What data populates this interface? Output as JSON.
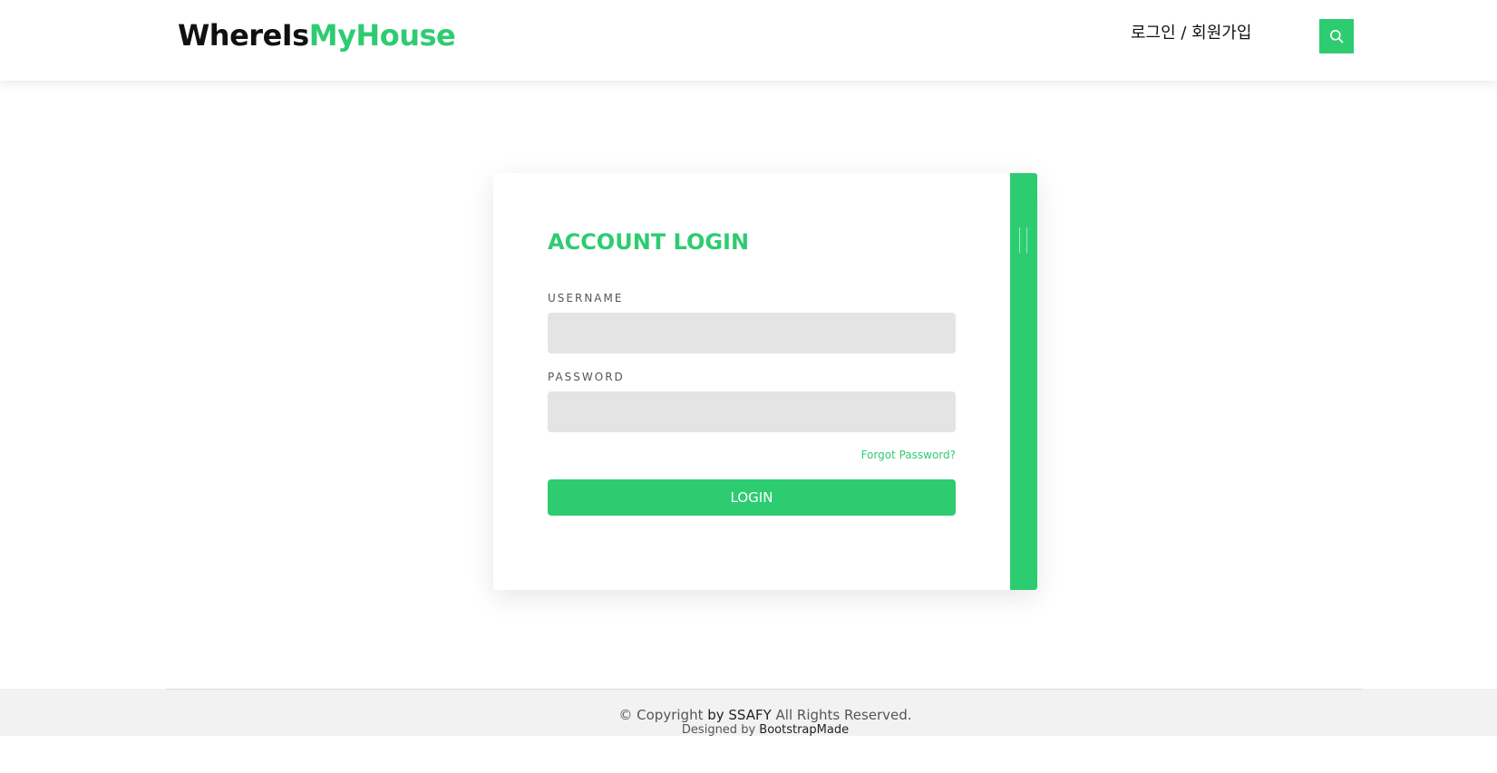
{
  "header": {
    "logo_part1": "WhereIs",
    "logo_part2": "MyHouse",
    "nav_login_signup": "로그인 / 회원가입",
    "search_icon": "search-icon"
  },
  "login": {
    "title": "ACCOUNT LOGIN",
    "username_label": "USERNAME",
    "username_value": "",
    "password_label": "PASSWORD",
    "password_value": "",
    "forgot_link": "Forgot Password?",
    "submit_label": "LOGIN"
  },
  "footer": {
    "copyright_prefix": "© Copyright ",
    "copyright_brand": "by SSAFY",
    "copyright_suffix": " All Rights Reserved.",
    "designed_prefix": "Designed by ",
    "designed_brand": "BootstrapMade"
  },
  "colors": {
    "accent": "#2ecc71",
    "input_bg": "#e4e4e4",
    "footer_bg": "#f2f2f2"
  }
}
